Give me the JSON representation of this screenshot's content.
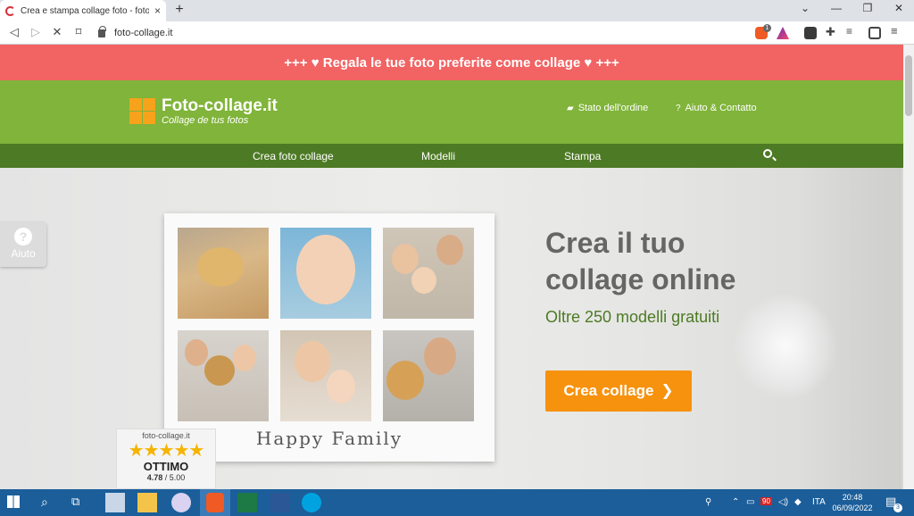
{
  "browser": {
    "tab_title": "Crea e stampa collage foto - foto-",
    "tab_close": "×",
    "new_tab": "+",
    "url": "foto-collage.it",
    "ext_badge": "1"
  },
  "site": {
    "banner": "+++ ♥ Regala le tue foto preferite come collage ♥ +++",
    "logo_name": "Foto-collage.it",
    "logo_tagline": "Collage de tus fotos",
    "header_links": {
      "order_status": "Stato dell'ordine",
      "help_contact": "Aiuto & Contatto"
    },
    "menu": [
      "Crea foto collage",
      "Modelli",
      "Stampa"
    ],
    "collage_caption": "Happy Family",
    "hero_title_line1": "Crea il tuo",
    "hero_title_line2": "collage online",
    "hero_subtitle": "Oltre 250 modelli gratuiti",
    "cta": "Crea collage",
    "help_label": "Aiuto",
    "rating": {
      "site": "foto-collage.it",
      "label": "OTTIMO",
      "score": "4.78",
      "max": "/ 5.00",
      "stars": 5
    }
  },
  "taskbar": {
    "lang": "ITA",
    "time": "20:48",
    "date": "06/09/2022",
    "notif_count": "3",
    "red_badge": "90"
  },
  "colors": {
    "banner": "#f26363",
    "header": "#80b43a",
    "menubar": "#4d7a24",
    "cta": "#f7920f",
    "taskbar": "#1b5e9a"
  }
}
